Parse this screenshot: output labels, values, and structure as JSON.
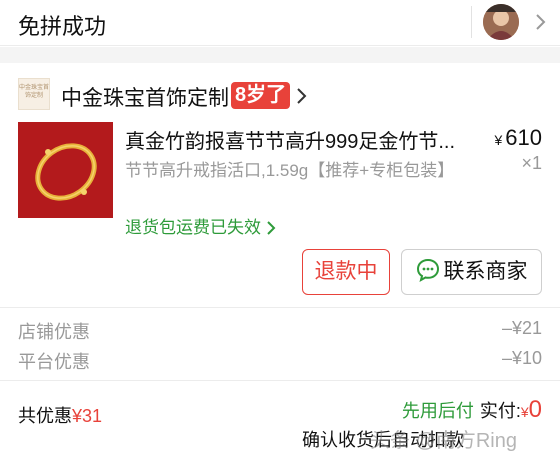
{
  "header": {
    "title": "免拼成功"
  },
  "shop": {
    "logo_text": "中金珠宝首饰定制",
    "name": "中金珠宝首饰定制",
    "age_badge": "8岁了"
  },
  "product": {
    "title": "真金竹韵报喜节节高升999足金竹节...",
    "spec": "节节高升戒指活口,1.59g【推荐+专柜包装】",
    "price_symbol": "¥",
    "price": "610",
    "quantity": "×1",
    "return_note": "退货包运费已失效"
  },
  "actions": {
    "refund_label": "退款中",
    "contact_label": "联系商家"
  },
  "discounts": [
    {
      "label": "店铺优惠",
      "value": "–¥21"
    },
    {
      "label": "平台优惠",
      "value": "–¥10"
    }
  ],
  "summary": {
    "total_discount_label": "共优惠",
    "total_discount_value": "¥31",
    "pay_later": "先用后付",
    "paid_label": "实付:",
    "currency": "¥",
    "paid_value": "0",
    "confirm_text": "确认收货后自动扣款"
  },
  "watermark": "头条 @南方Ring",
  "colors": {
    "accent_red": "#e8423a",
    "green": "#2e9b3a",
    "product_bg": "#b31a1c"
  },
  "icons": {
    "header_chevron": "chevron-right-icon",
    "shop_arrow": "chevron-right-icon",
    "chat": "chat-bubble-icon"
  }
}
